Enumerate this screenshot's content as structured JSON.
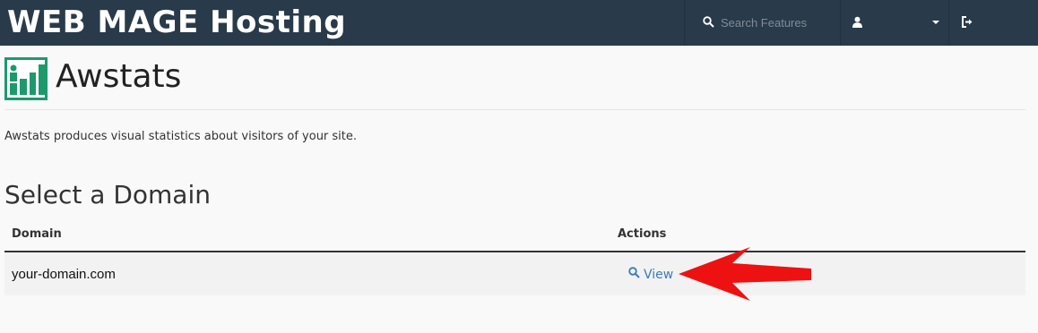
{
  "header": {
    "brand": "WEB MAGE Hosting",
    "search_placeholder": "Search Features",
    "colors": {
      "bar": "#293a4a",
      "text": "#ffffff"
    }
  },
  "page": {
    "title": "Awstats",
    "description": "Awstats produces visual statistics about visitors of your site.",
    "section_title": "Select a Domain"
  },
  "table": {
    "columns": [
      "Domain",
      "Actions"
    ],
    "rows": [
      {
        "domain": "your-domain.com",
        "action_label": "View"
      }
    ]
  },
  "icons": {
    "search": "search-icon",
    "user": "user-icon",
    "logout": "logout-icon",
    "awstats": "awstats-icon",
    "view": "magnifier-icon",
    "arrow": "red-arrow"
  },
  "colors": {
    "accent": "#3b7ab8",
    "icon_green": "#1c9a6c",
    "arrow": "#ee1111"
  }
}
